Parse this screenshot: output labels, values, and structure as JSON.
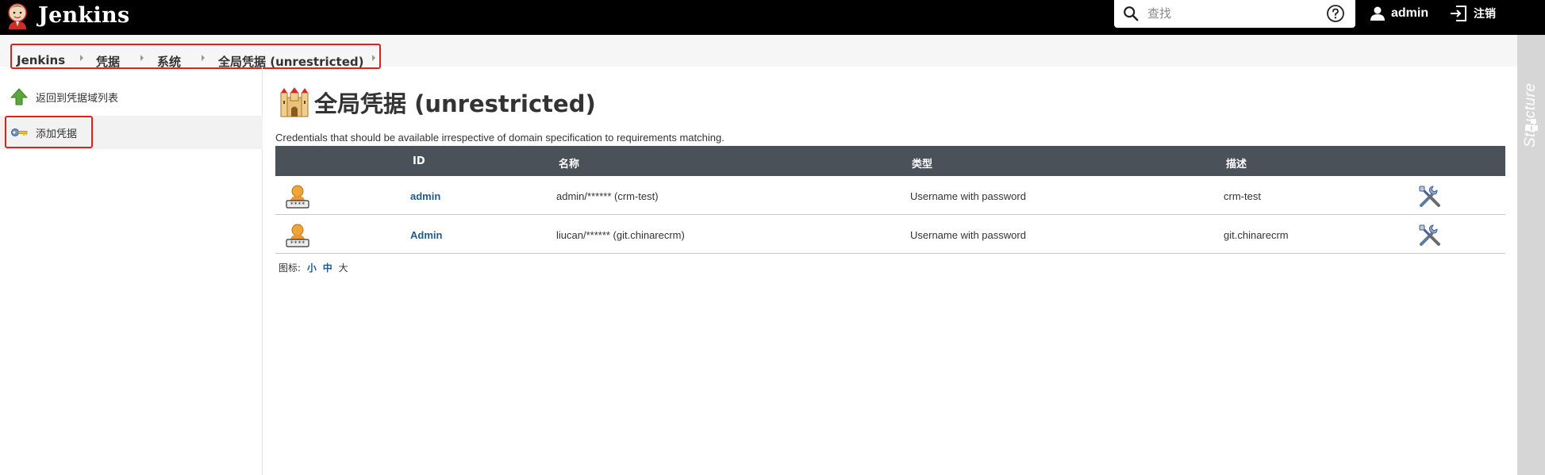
{
  "header": {
    "app_name": "Jenkins",
    "search_placeholder": "查找",
    "user_name": "admin",
    "logout_label": "注销"
  },
  "breadcrumb": {
    "items": [
      "Jenkins",
      "凭据",
      "系统",
      "全局凭据 (unrestricted)"
    ]
  },
  "structure": {
    "label": "Structure"
  },
  "sidebar": {
    "items": [
      {
        "label": "返回到凭据域列表",
        "icon": "up-arrow-icon"
      },
      {
        "label": "添加凭据",
        "icon": "key-icon"
      }
    ]
  },
  "main": {
    "title": "全局凭据 (unrestricted)",
    "description": "Credentials that should be available irrespective of domain specification to requirements matching.",
    "table": {
      "headers": [
        "ID",
        "名称",
        "类型",
        "描述"
      ],
      "rows": [
        {
          "id": "admin",
          "name": "admin/****** (crm-test)",
          "type": "Username with password",
          "description": "crm-test"
        },
        {
          "id": "Admin",
          "name": "liucan/****** (git.chinarecrm)",
          "type": "Username with password",
          "description": "git.chinarecrm"
        }
      ]
    },
    "icon_size": {
      "label": "图标:",
      "small": "小",
      "medium": "中",
      "large": "大"
    }
  },
  "colors": {
    "header_bg": "#000000",
    "table_header_bg": "#4a5159",
    "link": "#215a8f",
    "highlight_border": "#e0201b"
  }
}
